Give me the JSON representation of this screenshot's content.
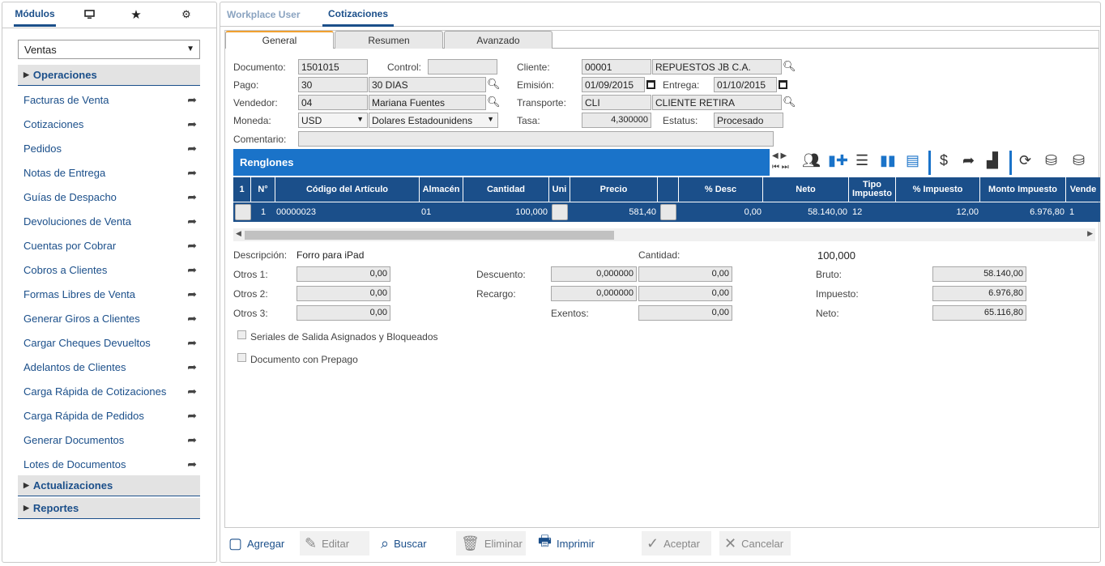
{
  "left_tabs": {
    "modulos": "Módulos",
    "monitor_icon": "monitor-icon",
    "star_icon": "star-icon",
    "settings_icon": "settings-icon"
  },
  "module_select": {
    "value": "Ventas"
  },
  "sections": {
    "operaciones": "Operaciones",
    "actualizaciones": "Actualizaciones",
    "reportes": "Reportes"
  },
  "menu_items": [
    "Facturas de Venta",
    "Cotizaciones",
    "Pedidos",
    "Notas de Entrega",
    "Guías de Despacho",
    "Devoluciones de Venta",
    "Cuentas por Cobrar",
    "Cobros a Clientes",
    "Formas Libres de Venta",
    "Generar Giros a Clientes",
    "Cargar Cheques Devueltos",
    "Adelantos de Clientes",
    "Carga Rápida de Cotizaciones",
    "Carga Rápida de Pedidos",
    "Generar Documentos",
    "Lotes de Documentos"
  ],
  "top_tabs": {
    "workplace": "Workplace User",
    "cotizaciones": "Cotizaciones"
  },
  "inner_tabs": {
    "general": "General",
    "resumen": "Resumen",
    "avanzado": "Avanzado"
  },
  "form": {
    "documento_label": "Documento:",
    "documento": "1501015",
    "control_label": "Control:",
    "control": "",
    "cliente_label": "Cliente:",
    "cliente_code": "00001",
    "cliente_name": "REPUESTOS JB C.A.",
    "pago_label": "Pago:",
    "pago_code": "30",
    "pago_name": "30 DIAS",
    "emision_label": "Emisión:",
    "emision": "01/09/2015",
    "entrega_label": "Entrega:",
    "entrega": "01/10/2015",
    "vendedor_label": "Vendedor:",
    "vendedor_code": "04",
    "vendedor_name": "Mariana Fuentes",
    "transporte_label": "Transporte:",
    "transporte_code": "CLI",
    "transporte_name": "CLIENTE RETIRA",
    "moneda_label": "Moneda:",
    "moneda_code": "USD",
    "moneda_name": "Dolares Estadounidens",
    "tasa_label": "Tasa:",
    "tasa": "4,300000",
    "estatus_label": "Estatus:",
    "estatus": "Procesado",
    "comentario_label": "Comentario:",
    "comentario": ""
  },
  "grid": {
    "title": "Renglones",
    "columns": [
      "1",
      "N°",
      "Código del Artículo",
      "Almacén",
      "Cantidad",
      "Uni",
      "Precio",
      "",
      "% Desc",
      "Neto",
      "Tipo Impuesto",
      "% Impuesto",
      "Monto Impuesto",
      "Vende"
    ],
    "row": {
      "n": "1",
      "codigo": "00000023",
      "almacen": "01",
      "cantidad": "100,000",
      "precio": "581,40",
      "desc": "0,00",
      "neto": "58.140,00",
      "tipo_imp": "12",
      "pct_imp": "12,00",
      "monto_imp": "6.976,80",
      "vende": "1"
    }
  },
  "summary": {
    "descripcion_label": "Descripción:",
    "descripcion": "Forro para iPad",
    "cantidad_label": "Cantidad:",
    "cantidad": "100,000",
    "otros1_label": "Otros 1:",
    "otros1": "0,00",
    "otros2_label": "Otros 2:",
    "otros2": "0,00",
    "otros3_label": "Otros 3:",
    "otros3": "0,00",
    "descuento_label": "Descuento:",
    "descuento_pct": "0,000000",
    "descuento": "0,00",
    "recargo_label": "Recargo:",
    "recargo_pct": "0,000000",
    "recargo": "0,00",
    "exentos_label": "Exentos:",
    "exentos": "0,00",
    "bruto_label": "Bruto:",
    "bruto": "58.140,00",
    "impuesto_label": "Impuesto:",
    "impuesto": "6.976,80",
    "neto_label": "Neto:",
    "neto": "65.116,80",
    "seriales_label": "Seriales de Salida Asignados y Bloqueados",
    "prepago_label": "Documento con Prepago"
  },
  "buttons": {
    "agregar": "Agregar",
    "editar": "Editar",
    "buscar": "Buscar",
    "eliminar": "Eliminar",
    "imprimir": "Imprimir",
    "aceptar": "Aceptar",
    "cancelar": "Cancelar"
  },
  "colors": {
    "primary": "#1b4f8a",
    "grid_bar": "#1a73c9",
    "active_tab_accent": "#f0a030"
  }
}
